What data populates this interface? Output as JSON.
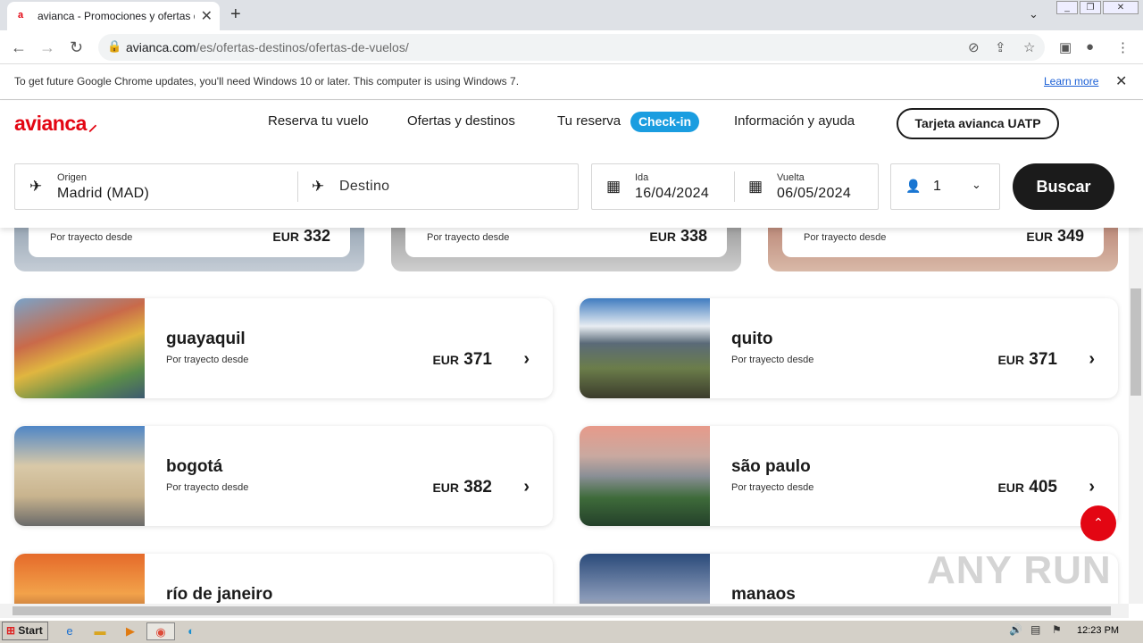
{
  "browser": {
    "tab_title": "avianca - Promociones y ofertas de vuelos",
    "tab_favicon": "a",
    "url_host": "avianca.com",
    "url_path": "/es/ofertas-destinos/ofertas-de-vuelos/",
    "infobar_text": "To get future Google Chrome updates, you'll need Windows 10 or later. This computer is using Windows 7.",
    "infobar_link": "Learn more"
  },
  "header": {
    "logo": "avianca",
    "nav": [
      "Reserva tu vuelo",
      "Ofertas y destinos",
      "Tu reserva",
      "Información y ayuda"
    ],
    "checkin": "Check-in",
    "uatp": "Tarjeta avianca UATP"
  },
  "search": {
    "origin_label": "Origen",
    "origin_value": "Madrid (MAD)",
    "dest_placeholder": "Destino",
    "depart_label": "Ida",
    "depart_value": "16/04/2024",
    "return_label": "Vuelta",
    "return_value": "06/05/2024",
    "passengers": "1",
    "button": "Buscar"
  },
  "top_cards": [
    {
      "desc": "Por trayecto desde",
      "currency": "EUR",
      "price": "332"
    },
    {
      "desc": "Por trayecto desde",
      "currency": "EUR",
      "price": "338"
    },
    {
      "desc": "Por trayecto desde",
      "currency": "EUR",
      "price": "349"
    }
  ],
  "destinations": [
    {
      "city": "guayaquil",
      "desc": "Por trayecto desde",
      "currency": "EUR",
      "price": "371"
    },
    {
      "city": "quito",
      "desc": "Por trayecto desde",
      "currency": "EUR",
      "price": "371"
    },
    {
      "city": "bogotá",
      "desc": "Por trayecto desde",
      "currency": "EUR",
      "price": "382"
    },
    {
      "city": "são paulo",
      "desc": "Por trayecto desde",
      "currency": "EUR",
      "price": "405"
    },
    {
      "city": "río de janeiro",
      "desc": "",
      "currency": "",
      "price": ""
    },
    {
      "city": "manaos",
      "desc": "",
      "currency": "",
      "price": ""
    }
  ],
  "watermark": "ANY RUN",
  "taskbar": {
    "start": "Start",
    "clock": "12:23 PM"
  },
  "colors": {
    "brand": "#e30613",
    "checkin": "#1a9de0",
    "button": "#1b1b1b"
  }
}
